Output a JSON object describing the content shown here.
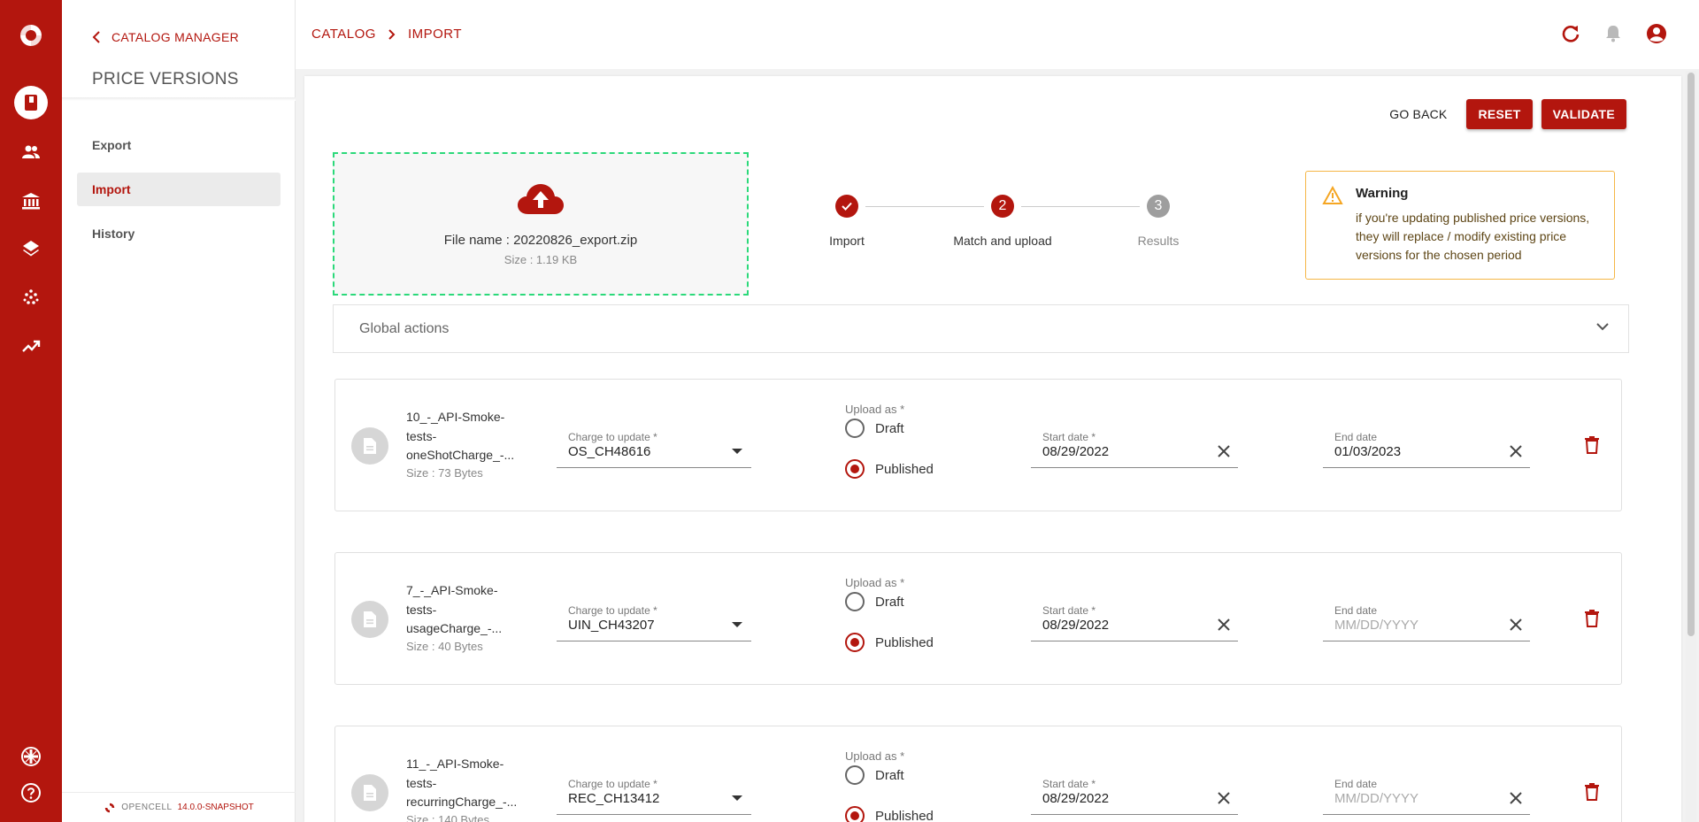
{
  "sidebar": {
    "back_label": "CATALOG MANAGER",
    "title": "PRICE VERSIONS",
    "nav": [
      {
        "label": "Export"
      },
      {
        "label": "Import"
      },
      {
        "label": "History"
      }
    ],
    "footer_name": "OPENCELL",
    "footer_version": "14.0.0-SNAPSHOT"
  },
  "breadcrumb": [
    "CATALOG",
    "IMPORT"
  ],
  "actions": {
    "go_back": "GO BACK",
    "reset": "RESET",
    "validate": "VALIDATE"
  },
  "upload": {
    "file_name": "File name : 20220826_export.zip",
    "file_size": "Size : 1.19 KB"
  },
  "stepper": {
    "steps": [
      {
        "label": "Import",
        "state": "done"
      },
      {
        "label": "Match and upload",
        "number": "2",
        "state": "active"
      },
      {
        "label": "Results",
        "number": "3",
        "state": "pending"
      }
    ]
  },
  "warning": {
    "title": "Warning",
    "text": "if you're updating published price versions, they will replace / modify existing price versions for the chosen period"
  },
  "global_actions": {
    "label": "Global actions"
  },
  "labels": {
    "charge_to_update": "Charge to update *",
    "upload_as": "Upload as *",
    "draft": "Draft",
    "published": "Published",
    "start_date": "Start date *",
    "end_date": "End date",
    "date_placeholder": "MM/DD/YYYY"
  },
  "files": [
    {
      "name_lines": [
        "10_-_API-Smoke-",
        "tests-",
        "oneShotCharge_-..."
      ],
      "size": "Size : 73 Bytes",
      "charge": "OS_CH48616",
      "upload_as": "Published",
      "start_date": "08/29/2022",
      "end_date": "01/03/2023"
    },
    {
      "name_lines": [
        "7_-_API-Smoke-",
        "tests-",
        "usageCharge_-..."
      ],
      "size": "Size : 40 Bytes",
      "charge": "UIN_CH43207",
      "upload_as": "Published",
      "start_date": "08/29/2022",
      "end_date": ""
    },
    {
      "name_lines": [
        "11_-_API-Smoke-",
        "tests-",
        "recurringCharge_-..."
      ],
      "size": "Size : 140 Bytes",
      "charge": "REC_CH13412",
      "upload_as": "Published",
      "start_date": "08/29/2022",
      "end_date": ""
    }
  ],
  "colors": {
    "brand": "#b3160e",
    "dropzone_border": "#2bd97a",
    "warning_border": "#f5b646"
  },
  "icons": {
    "rail": [
      "opencell-logo-icon",
      "catalog-book-icon",
      "people-icon",
      "bank-icon",
      "layers-icon",
      "dots-grid-icon",
      "trending-up-icon",
      "language-flag-icon",
      "help-icon"
    ],
    "top": [
      "refresh-icon",
      "bell-icon",
      "account-icon"
    ]
  }
}
